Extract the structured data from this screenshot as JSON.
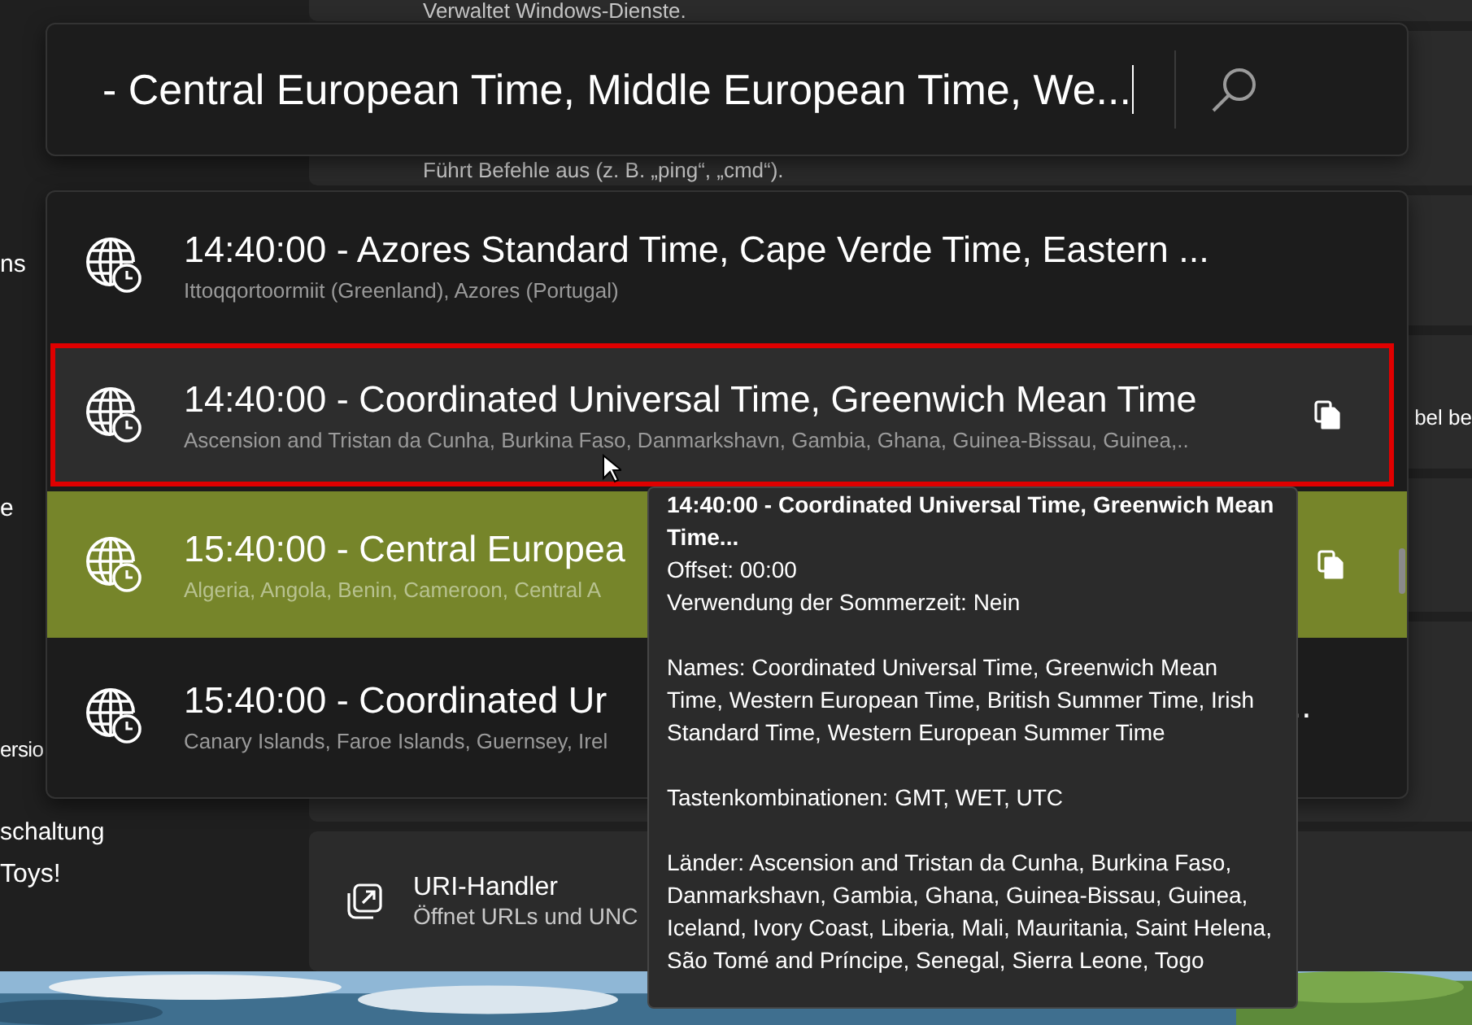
{
  "background": {
    "sidebar_fragments": [
      {
        "label": "ns"
      },
      {
        "label": "e"
      },
      {
        "label": "ersio"
      },
      {
        "label": "schaltung"
      },
      {
        "label": "Toys!"
      }
    ],
    "cards": [
      {
        "kind": "text",
        "description": "Verwaltet Windows-Dienste."
      },
      {
        "kind": "text",
        "description": "Führt Befehle aus (z. B. „ping“, „cmd“)."
      },
      {
        "kind": "plain"
      },
      {
        "kind": "edge",
        "description": "bel be"
      },
      {
        "kind": "plain"
      },
      {
        "kind": "plain"
      },
      {
        "kind": "uri",
        "title": "URI-Handler",
        "description": "Öffnet URLs und UNC"
      }
    ]
  },
  "launcher": {
    "search": {
      "value": "- Central European Time, Middle European Time, We..."
    },
    "results": [
      {
        "title": "14:40:00 - Azores Standard Time, Cape Verde Time, Eastern ...",
        "subtitle": "Ittoqqortoormiit (Greenland), Azores (Portugal)",
        "selected": false,
        "marked": false,
        "copy_button": false
      },
      {
        "title": "14:40:00 - Coordinated Universal Time, Greenwich Mean Time",
        "subtitle": "Ascension and Tristan da Cunha, Burkina Faso, Danmarkshavn, Gambia, Ghana, Guinea-Bissau, Guinea,..",
        "selected": false,
        "marked": true,
        "copy_button": true
      },
      {
        "title": "15:40:00 - Central Europea",
        "subtitle": "Algeria, Angola, Benin, Cameroon, Central A",
        "selected": true,
        "marked": false,
        "copy_button": true
      },
      {
        "title": "15:40:00 - Coordinated Ur",
        "subtitle": "Canary Islands, Faroe Islands, Guernsey, Irel",
        "selected": false,
        "marked": false,
        "copy_button": false,
        "tail": ".."
      }
    ]
  },
  "tooltip": {
    "title": "14:40:00 - Coordinated Universal Time, Greenwich Mean Time...",
    "lines": [
      "Offset: 00:00",
      "Verwendung der Sommerzeit: Nein"
    ],
    "paragraphs": [
      "Names: Coordinated Universal Time, Greenwich Mean Time, Western European Time, British Summer Time, Irish Standard Time, Western European Summer Time",
      "Tastenkombinationen: GMT, WET, UTC",
      "Länder: Ascension and Tristan da Cunha, Burkina Faso, Danmarkshavn, Gambia, Ghana, Guinea-Bissau, Guinea, Iceland, Ivory Coast, Liberia, Mali, Mauritania, Saint Helena, São Tomé and Príncipe, Senegal, Sierra Leone, Togo"
    ]
  }
}
